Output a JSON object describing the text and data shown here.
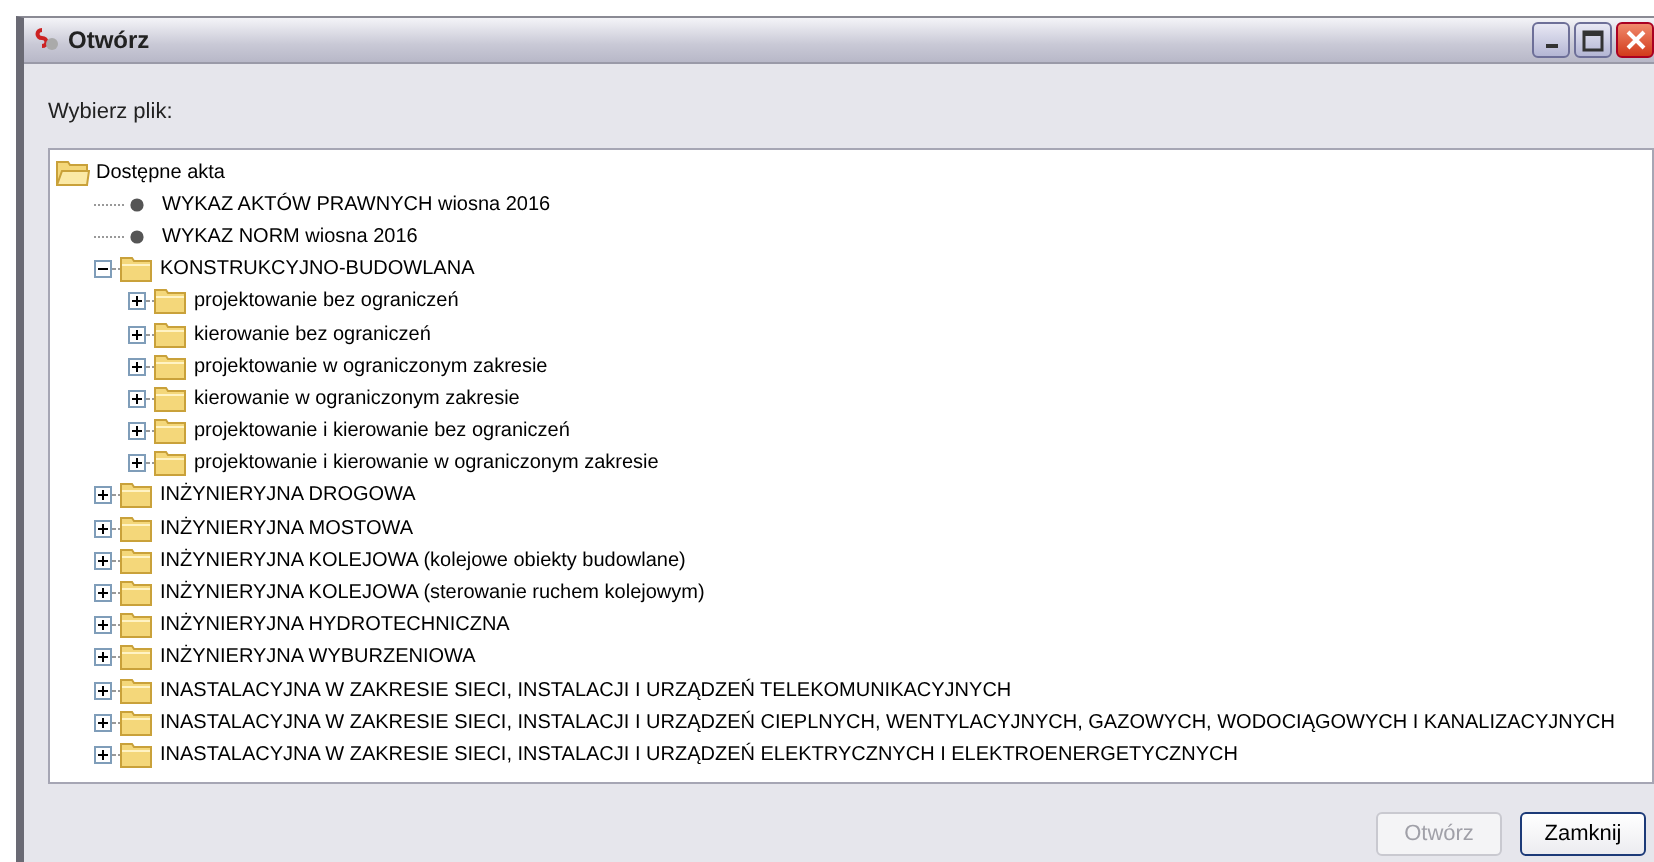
{
  "window": {
    "title": "Otwórz"
  },
  "prompt": "Wybierz plik:",
  "tree": [
    {
      "kind": "folder",
      "label": "Dostępne akta",
      "expanded": true,
      "children": [
        {
          "kind": "document",
          "label": "WYKAZ AKTÓW PRAWNYCH wiosna 2016"
        },
        {
          "kind": "document",
          "label": "WYKAZ NORM wiosna 2016"
        },
        {
          "kind": "folder",
          "label": "KONSTRUKCYJNO-BUDOWLANA",
          "expanded": true,
          "children": [
            {
              "kind": "folder",
              "label": "projektowanie bez ograniczeń",
              "expanded": false
            },
            {
              "kind": "folder",
              "label": "kierowanie bez ograniczeń",
              "expanded": false
            },
            {
              "kind": "folder",
              "label": "projektowanie w ograniczonym zakresie",
              "expanded": false
            },
            {
              "kind": "folder",
              "label": "kierowanie w ograniczonym zakresie",
              "expanded": false
            },
            {
              "kind": "folder",
              "label": "projektowanie i kierowanie bez ograniczeń",
              "expanded": false
            },
            {
              "kind": "folder",
              "label": "projektowanie i kierowanie w ograniczonym zakresie",
              "expanded": false
            }
          ]
        },
        {
          "kind": "folder",
          "label": "INŻYNIERYJNA DROGOWA",
          "expanded": false
        },
        {
          "kind": "folder",
          "label": "INŻYNIERYJNA MOSTOWA",
          "expanded": false
        },
        {
          "kind": "folder",
          "label": "INŻYNIERYJNA KOLEJOWA (kolejowe obiekty budowlane)",
          "expanded": false
        },
        {
          "kind": "folder",
          "label": "INŻYNIERYJNA KOLEJOWA (sterowanie ruchem kolejowym)",
          "expanded": false
        },
        {
          "kind": "folder",
          "label": "INŻYNIERYJNA HYDROTECHNICZNA",
          "expanded": false
        },
        {
          "kind": "folder",
          "label": "INŻYNIERYJNA WYBURZENIOWA",
          "expanded": false
        },
        {
          "kind": "folder",
          "label": "INASTALACYJNA W ZAKRESIE SIECI, INSTALACJI I URZĄDZEŃ TELEKOMUNIKACYJNYCH",
          "expanded": false
        },
        {
          "kind": "folder",
          "label": "INASTALACYJNA W ZAKRESIE SIECI, INSTALACJI I URZĄDZEŃ CIEPLNYCH, WENTYLACYJNYCH, GAZOWYCH, WODOCIĄGOWYCH I KANALIZACYJNYCH",
          "expanded": false
        },
        {
          "kind": "folder",
          "label": "INASTALACYJNA W ZAKRESIE SIECI, INSTALACJI I URZĄDZEŃ ELEKTRYCZNYCH I ELEKTROENERGETYCZNYCH",
          "expanded": false
        }
      ]
    }
  ],
  "buttons": [
    {
      "label": "Otwórz",
      "disabled": true
    },
    {
      "label": "Zamknij",
      "disabled": false
    }
  ]
}
